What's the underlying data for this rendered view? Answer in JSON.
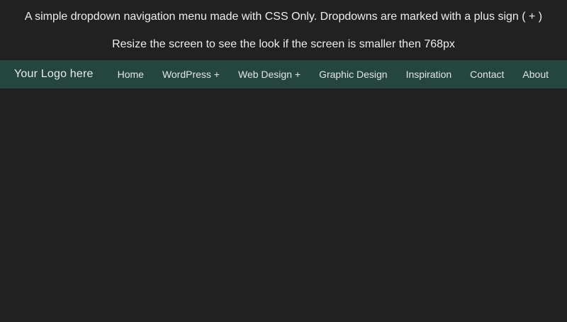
{
  "page": {
    "background_color": "#212121",
    "text_color": "#eeeeee",
    "intro": {
      "line1": "A simple dropdown navigation menu made with CSS Only. Dropdowns are marked with a plus sign ( + )",
      "line2": "Resize the screen to see the look if the screen is smaller then 768px"
    }
  },
  "navbar": {
    "background_color": "#25453f",
    "item_text_color": "#e2e5e4",
    "logo_label": "Your Logo here",
    "dropdown_marker": "+",
    "items": [
      {
        "label": "Home",
        "has_dropdown": false
      },
      {
        "label": "WordPress +",
        "has_dropdown": true
      },
      {
        "label": "Web Design +",
        "has_dropdown": true
      },
      {
        "label": "Graphic Design",
        "has_dropdown": false
      },
      {
        "label": "Inspiration",
        "has_dropdown": false
      },
      {
        "label": "Contact",
        "has_dropdown": false
      },
      {
        "label": "About",
        "has_dropdown": false
      }
    ]
  }
}
